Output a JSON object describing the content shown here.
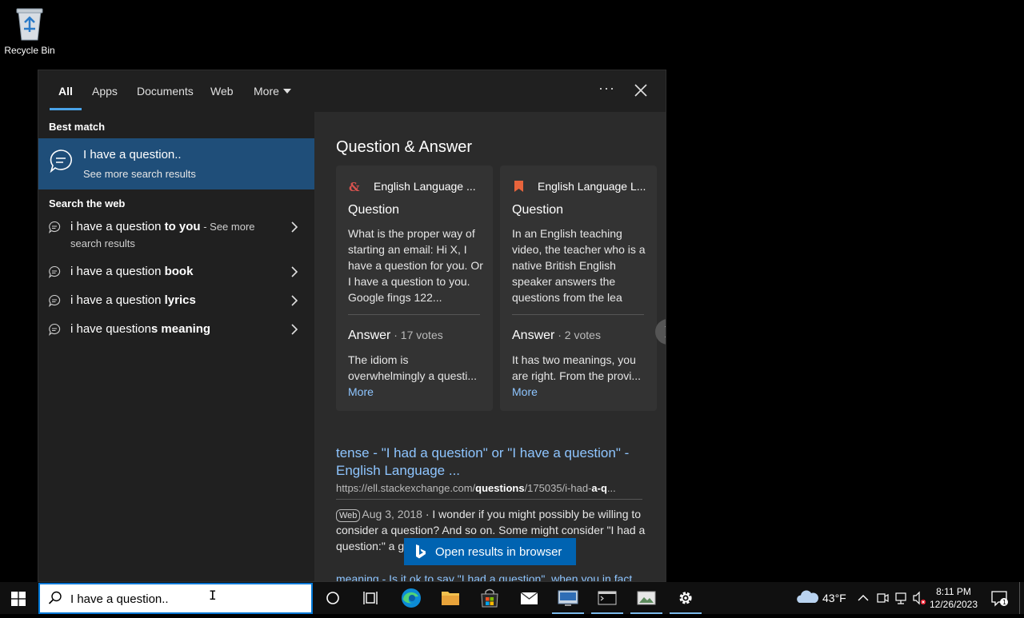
{
  "desktop": {
    "recycle_bin_label": "Recycle Bin"
  },
  "search_panel": {
    "tabs": [
      "All",
      "Apps",
      "Documents",
      "Web",
      "More"
    ],
    "best_match": {
      "section": "Best match",
      "title": "I have a question..",
      "subtitle": "See more search results"
    },
    "search_web": {
      "section": "Search the web",
      "items": [
        {
          "normal": "i have a question ",
          "bold": "to you",
          "suffix": " - See more",
          "sub": "search results"
        },
        {
          "normal": "i have a question ",
          "bold": "book"
        },
        {
          "normal": "i have a question ",
          "bold": "lyrics"
        },
        {
          "normal": "i have question",
          "bold_mid": "s",
          "normal2": " ",
          "bold": "meaning"
        }
      ]
    },
    "qa": {
      "title": "Question & Answer",
      "cards": [
        {
          "site": "English Language ...",
          "question_label": "Question",
          "question": "What is the proper way of starting an email: Hi X, I have a question for you. Or I have a question to you. Google fings 122...",
          "answer_label": "Answer",
          "votes": " · 17 votes",
          "answer": "The idiom is overwhelmingly a questi...",
          "more": "More"
        },
        {
          "site": "English Language L...",
          "question_label": "Question",
          "question": "In an English teaching video, the teacher who is a native British English speaker answers the questions from the lea",
          "answer_label": "Answer",
          "votes": " · 2 votes",
          "answer": "It has two meanings, you are right. From the provi...",
          "more": "More"
        }
      ]
    },
    "result": {
      "title": "tense - \"I had a question\" or \"I have a question\" - English Language ...",
      "url_prefix": "https://ell.stackexchange.com/",
      "url_bold1": "questions",
      "url_mid": "/175035/i-had-",
      "url_bold2": "a-q",
      "url_tail": "...",
      "badge": "Web",
      "date": "Aug 3, 2018",
      "snippet": " · I wonder if you might possibly be willing to consider a question? And so on. Some might consider \"I had a question:\" a g",
      "next_link": "meaning - Is it ok to say \"I had a question\", when you in fact..."
    },
    "open_browser": "Open results in browser"
  },
  "taskbar": {
    "search_value": "I have a question..",
    "weather_temp": "43°F",
    "time": "8:11 PM",
    "date": "12/26/2023"
  },
  "colors": {
    "accent": "#0078d7",
    "selection": "#1f4e79",
    "link": "#8ec5ff"
  }
}
